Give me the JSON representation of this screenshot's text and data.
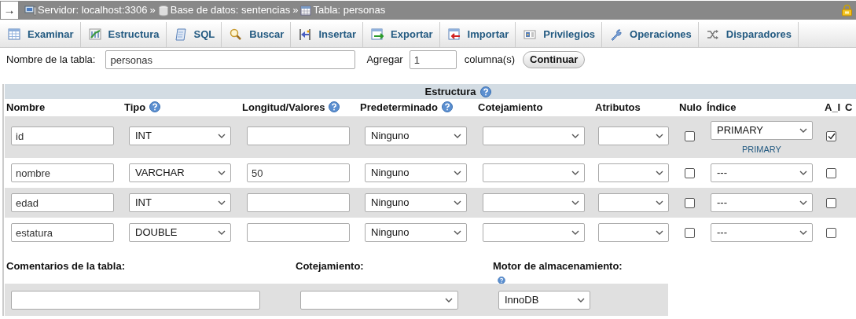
{
  "breadcrumb": {
    "arrow": "→",
    "items": [
      {
        "kind": "server",
        "label": "Servidor: localhost:3306"
      },
      {
        "kind": "database",
        "label": "Base de datos: sentencias"
      },
      {
        "kind": "table",
        "label": "Tabla: personas"
      }
    ],
    "separator": "»"
  },
  "tabs": [
    {
      "kind": "browse",
      "label": "Examinar"
    },
    {
      "kind": "structure",
      "label": "Estructura"
    },
    {
      "kind": "sql",
      "label": "SQL"
    },
    {
      "kind": "search",
      "label": "Buscar"
    },
    {
      "kind": "insert",
      "label": "Insertar"
    },
    {
      "kind": "export",
      "label": "Exportar"
    },
    {
      "kind": "import",
      "label": "Importar"
    },
    {
      "kind": "privileges",
      "label": "Privilegios"
    },
    {
      "kind": "operations",
      "label": "Operaciones"
    },
    {
      "kind": "triggers",
      "label": "Disparadores"
    }
  ],
  "table_name": {
    "label": "Nombre de la tabla:",
    "value": "personas",
    "add_label": "Agregar",
    "add_value": "1",
    "columns_label": "columna(s)",
    "button": "Continuar"
  },
  "structure": {
    "title": "Estructura",
    "columns": [
      {
        "label": "Nombre"
      },
      {
        "label": "Tipo",
        "help": true
      },
      {
        "label": "Longitud/Valores",
        "help": true
      },
      {
        "label": "Predeterminado",
        "help": true
      },
      {
        "label": "Cotejamiento"
      },
      {
        "label": "Atributos"
      },
      {
        "label": "Nulo"
      },
      {
        "label": "Índice"
      },
      {
        "label": "A_I"
      },
      {
        "label": "C"
      }
    ],
    "rows": [
      {
        "name": "id",
        "type": "INT",
        "length": "",
        "default": "Ninguno",
        "null": false,
        "index": "PRIMARY",
        "index_note": "PRIMARY",
        "ai": true
      },
      {
        "name": "nombre",
        "type": "VARCHAR",
        "length": "50",
        "default": "Ninguno",
        "null": false,
        "index": "---",
        "ai": false
      },
      {
        "name": "edad",
        "type": "INT",
        "length": "",
        "default": "Ninguno",
        "null": false,
        "index": "---",
        "ai": false
      },
      {
        "name": "estatura",
        "type": "DOUBLE",
        "length": "",
        "default": "Ninguno",
        "null": false,
        "index": "---",
        "ai": false
      }
    ]
  },
  "table_options": {
    "comments_label": "Comentarios de la tabla:",
    "collation_label": "Cotejamiento:",
    "engine_label": "Motor de almacenamiento:",
    "engine": "InnoDB"
  }
}
